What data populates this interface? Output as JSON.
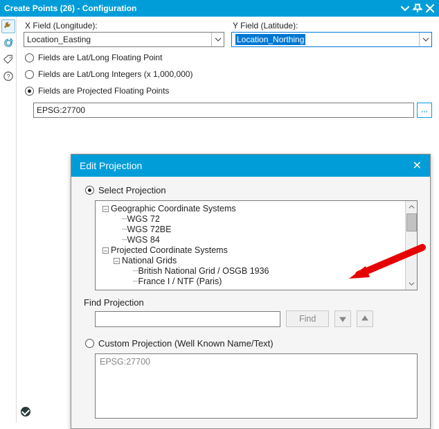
{
  "title": "Create Points (26) - Configuration",
  "fields": {
    "x_label": "X Field (Longitude):",
    "y_label": "Y Field (Latitude):",
    "x_value": "Location_Easting",
    "y_value": "Location_Northing"
  },
  "radios": {
    "latlong_float": "Fields are Lat/Long Floating Point",
    "latlong_int": "Fields are Lat/Long Integers (x 1,000,000)",
    "projected": "Fields are Projected Floating Points"
  },
  "proj_input": "EPSG:27700",
  "dialog": {
    "title": "Edit Projection",
    "select_label": "Select Projection",
    "find_label": "Find Projection",
    "find_btn": "Find",
    "custom_label": "Custom Projection (Well Known Name/Text)",
    "custom_value": "EPSG:27700",
    "tree": {
      "gcs": "Geographic Coordinate Systems",
      "wgs72": "WGS 72",
      "wgs72be": "WGS 72BE",
      "wgs84": "WGS 84",
      "pcs": "Projected Coordinate Systems",
      "natgrid": "National Grids",
      "bng": "British National Grid / OSGB 1936",
      "france": "France I / NTF (Paris)"
    }
  }
}
